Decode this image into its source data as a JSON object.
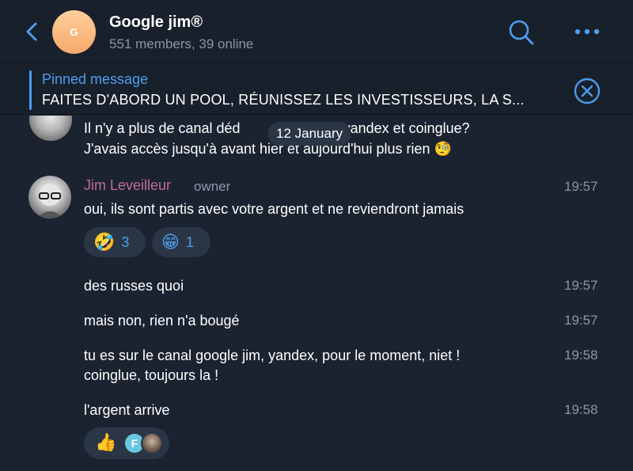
{
  "header": {
    "back_label": "",
    "avatar_initial": "G",
    "title": "Google jim®",
    "subtitle": "551 members, 39 online"
  },
  "pinned": {
    "title": "Pinned message",
    "text": "FAITES D'ABORD UN POOL, RÉUNISSEZ LES INVESTISSEURS, LA S..."
  },
  "date_pill": "12 January",
  "messages": [
    {
      "line1_before": "Il n'y a plus de canal déd",
      "line1_after": "yandex et coinglue?",
      "line2": "J'avais accès jusqu'à avant hier et aujourd'hui plus rien 🧐"
    },
    {
      "sender": "Jim Leveilleur",
      "role": "owner",
      "text": "oui, ils sont partis avec votre argent et ne reviendront jamais",
      "time": "19:57",
      "reactions": [
        {
          "emoji": "🤣",
          "count": "3"
        },
        {
          "emoji": "😁",
          "count": "1"
        }
      ]
    },
    {
      "text": "des russes quoi",
      "time": "19:57"
    },
    {
      "text": "mais non, rien n'a bougé",
      "time": "19:57"
    },
    {
      "line1": "tu es sur le canal google jim, yandex, pour le moment, niet !",
      "line2": "coinglue, toujours la !",
      "time": "19:58"
    },
    {
      "text": "l'argent arrive",
      "time": "19:58",
      "reaction_emoji": "👍",
      "reactor_initial": "F"
    }
  ],
  "colors": {
    "accent": "#4c9ded",
    "background": "#1b2330",
    "sender": "#c16a9b",
    "muted": "#8a97a8"
  },
  "icons": [
    "back-chevron-icon",
    "search-icon",
    "more-icon",
    "close-circle-icon"
  ]
}
